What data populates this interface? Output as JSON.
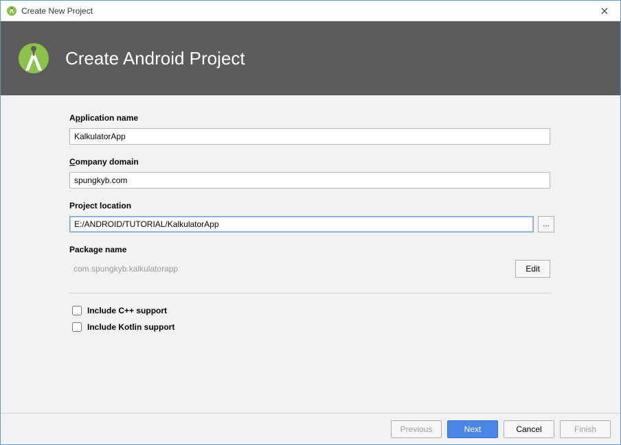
{
  "window": {
    "title": "Create New Project"
  },
  "banner": {
    "heading": "Create Android Project"
  },
  "form": {
    "app_name": {
      "label_pre": "A",
      "label_acc": "p",
      "label_post": "plication name",
      "value": "KalkulatorApp"
    },
    "company_domain": {
      "label_acc": "C",
      "label_post": "ompany domain",
      "value": "spungkyb.com"
    },
    "project_location": {
      "label": "Project location",
      "value": "E:/ANDROID/TUTORIAL/KalkulatorApp",
      "browse_label": "..."
    },
    "package": {
      "label": "Package name",
      "value": "com.spungkyb.kalkulatorapp",
      "edit_label": "Edit"
    },
    "cpp": {
      "label": "Include C++ support",
      "checked": false
    },
    "kotlin": {
      "label": "Include Kotlin support",
      "checked": false
    }
  },
  "footer": {
    "previous": "Previous",
    "next": "Next",
    "cancel": "Cancel",
    "finish": "Finish"
  },
  "icons": {
    "app": "android-studio-icon",
    "close": "close-icon"
  },
  "colors": {
    "primary": "#4a86e8",
    "banner_bg": "#5c5c5c",
    "form_bg": "#f2f2f2",
    "border_focus": "#7aa7d6"
  }
}
